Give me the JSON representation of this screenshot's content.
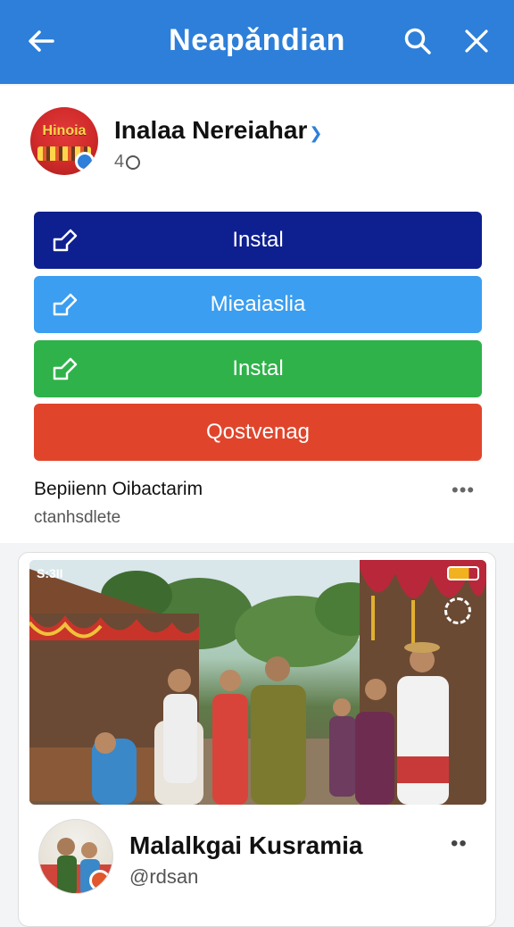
{
  "header": {
    "title": "Neapǎndian"
  },
  "app": {
    "avatar_text": "Hinoia",
    "name": "Inalaa Nereiahar",
    "sub_count": "4"
  },
  "buttons": [
    {
      "label": "Instal",
      "color": "#0e1f8f"
    },
    {
      "label": "Mieaiaslia",
      "color": "#3b9ef0"
    },
    {
      "label": "Instal",
      "color": "#2fb24a"
    },
    {
      "label": "Qostvenag",
      "color": "#e0452c"
    }
  ],
  "section": {
    "title": "Bepiienn Oibactarim",
    "subtitle": "ctanhsdlete"
  },
  "post": {
    "status_time": "S:3II",
    "name": "Malalkgai Kusramia",
    "handle": "@rdsan"
  },
  "colors": {
    "accent": "#2d7fd9"
  }
}
